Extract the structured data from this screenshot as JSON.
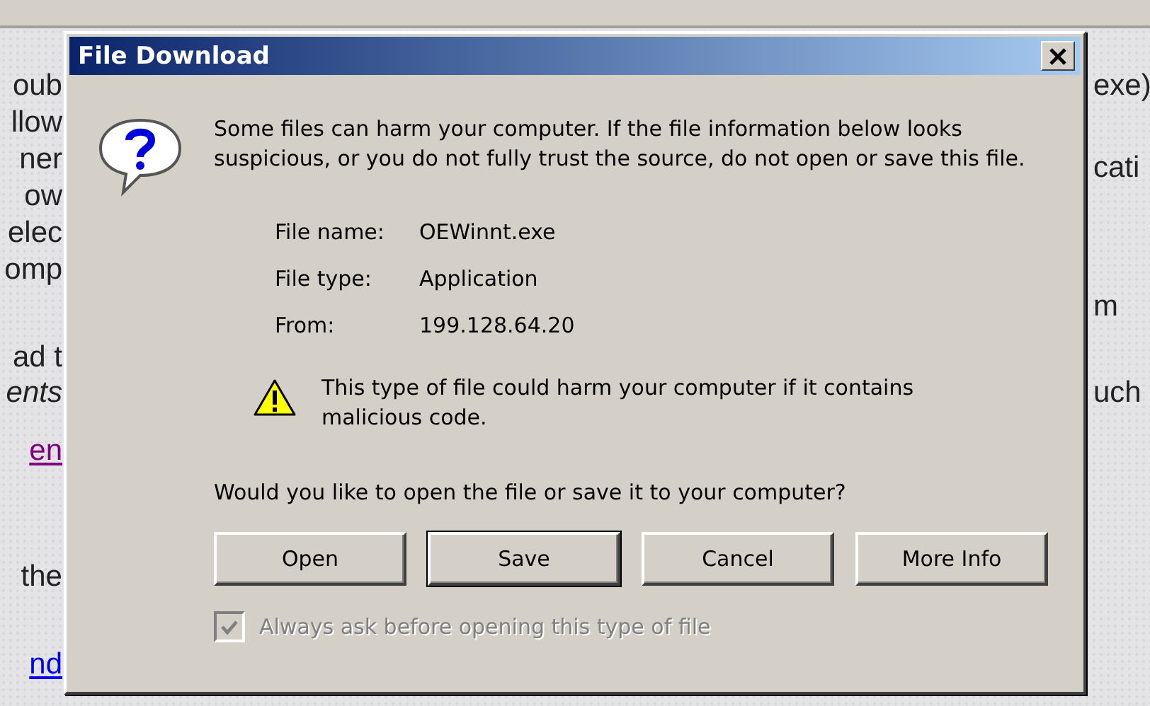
{
  "background_left": [
    {
      "text": "oub",
      "kind": "text"
    },
    {
      "text": "llow",
      "kind": "text"
    },
    {
      "text": "ner",
      "kind": "text"
    },
    {
      "text": "ow",
      "kind": "text"
    },
    {
      "text": "elec",
      "kind": "text"
    },
    {
      "text": "omp",
      "kind": "text"
    },
    {
      "text": "ad t",
      "kind": "text"
    },
    {
      "text": "ents",
      "kind": "italic"
    },
    {
      "text": "en",
      "kind": "visited-link"
    },
    {
      "text": "the",
      "kind": "text"
    },
    {
      "text": "nd",
      "kind": "link"
    }
  ],
  "background_right": [
    {
      "text": "exe)"
    },
    {
      "text": "cati"
    },
    {
      "text": "m"
    },
    {
      "text": "uch"
    }
  ],
  "dialog": {
    "title": "File Download",
    "message": "Some files can harm your computer. If the file information below looks suspicious, or you do not fully trust the source, do not open or save this file.",
    "fields": [
      {
        "label": "File name:",
        "value": "OEWinnt.exe"
      },
      {
        "label": "File type:",
        "value": "Application"
      },
      {
        "label": "From:",
        "value": "199.128.64.20"
      }
    ],
    "warning": "This type of file could harm your computer if it contains malicious code.",
    "question": "Would you like to open the file or save it to your computer?",
    "buttons": [
      {
        "label": "Open",
        "default": false
      },
      {
        "label": "Save",
        "default": true
      },
      {
        "label": "Cancel",
        "default": false
      },
      {
        "label": "More Info",
        "default": false
      }
    ],
    "checkbox": {
      "label": "Always ask before opening this type of file",
      "checked": true,
      "disabled": true
    }
  }
}
